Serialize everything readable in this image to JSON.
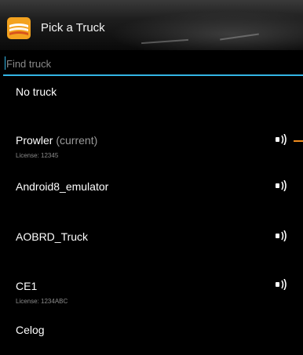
{
  "header": {
    "title": "Pick a Truck",
    "icon": "truck-app-icon"
  },
  "search": {
    "placeholder": "Find truck",
    "value": ""
  },
  "trucks": [
    {
      "name": "No truck",
      "suffix": "",
      "license": "",
      "icon": ""
    },
    {
      "name": "Prowler",
      "suffix": " (current)",
      "license": "License: 12345",
      "icon": "connection-signal-icon"
    },
    {
      "name": "Android8_emulator",
      "suffix": "",
      "license": "",
      "icon": "connection-signal-icon"
    },
    {
      "name": "AOBRD_Truck",
      "suffix": "",
      "license": "",
      "icon": "connection-signal-icon"
    },
    {
      "name": "CE1",
      "suffix": "",
      "license": "License: 1234ABC",
      "icon": "connection-signal-icon"
    },
    {
      "name": "Celog",
      "suffix": "",
      "license": "",
      "icon": ""
    }
  ],
  "colors": {
    "accent": "#33b5e5",
    "highlight": "#f08c1e",
    "background": "#000000"
  }
}
